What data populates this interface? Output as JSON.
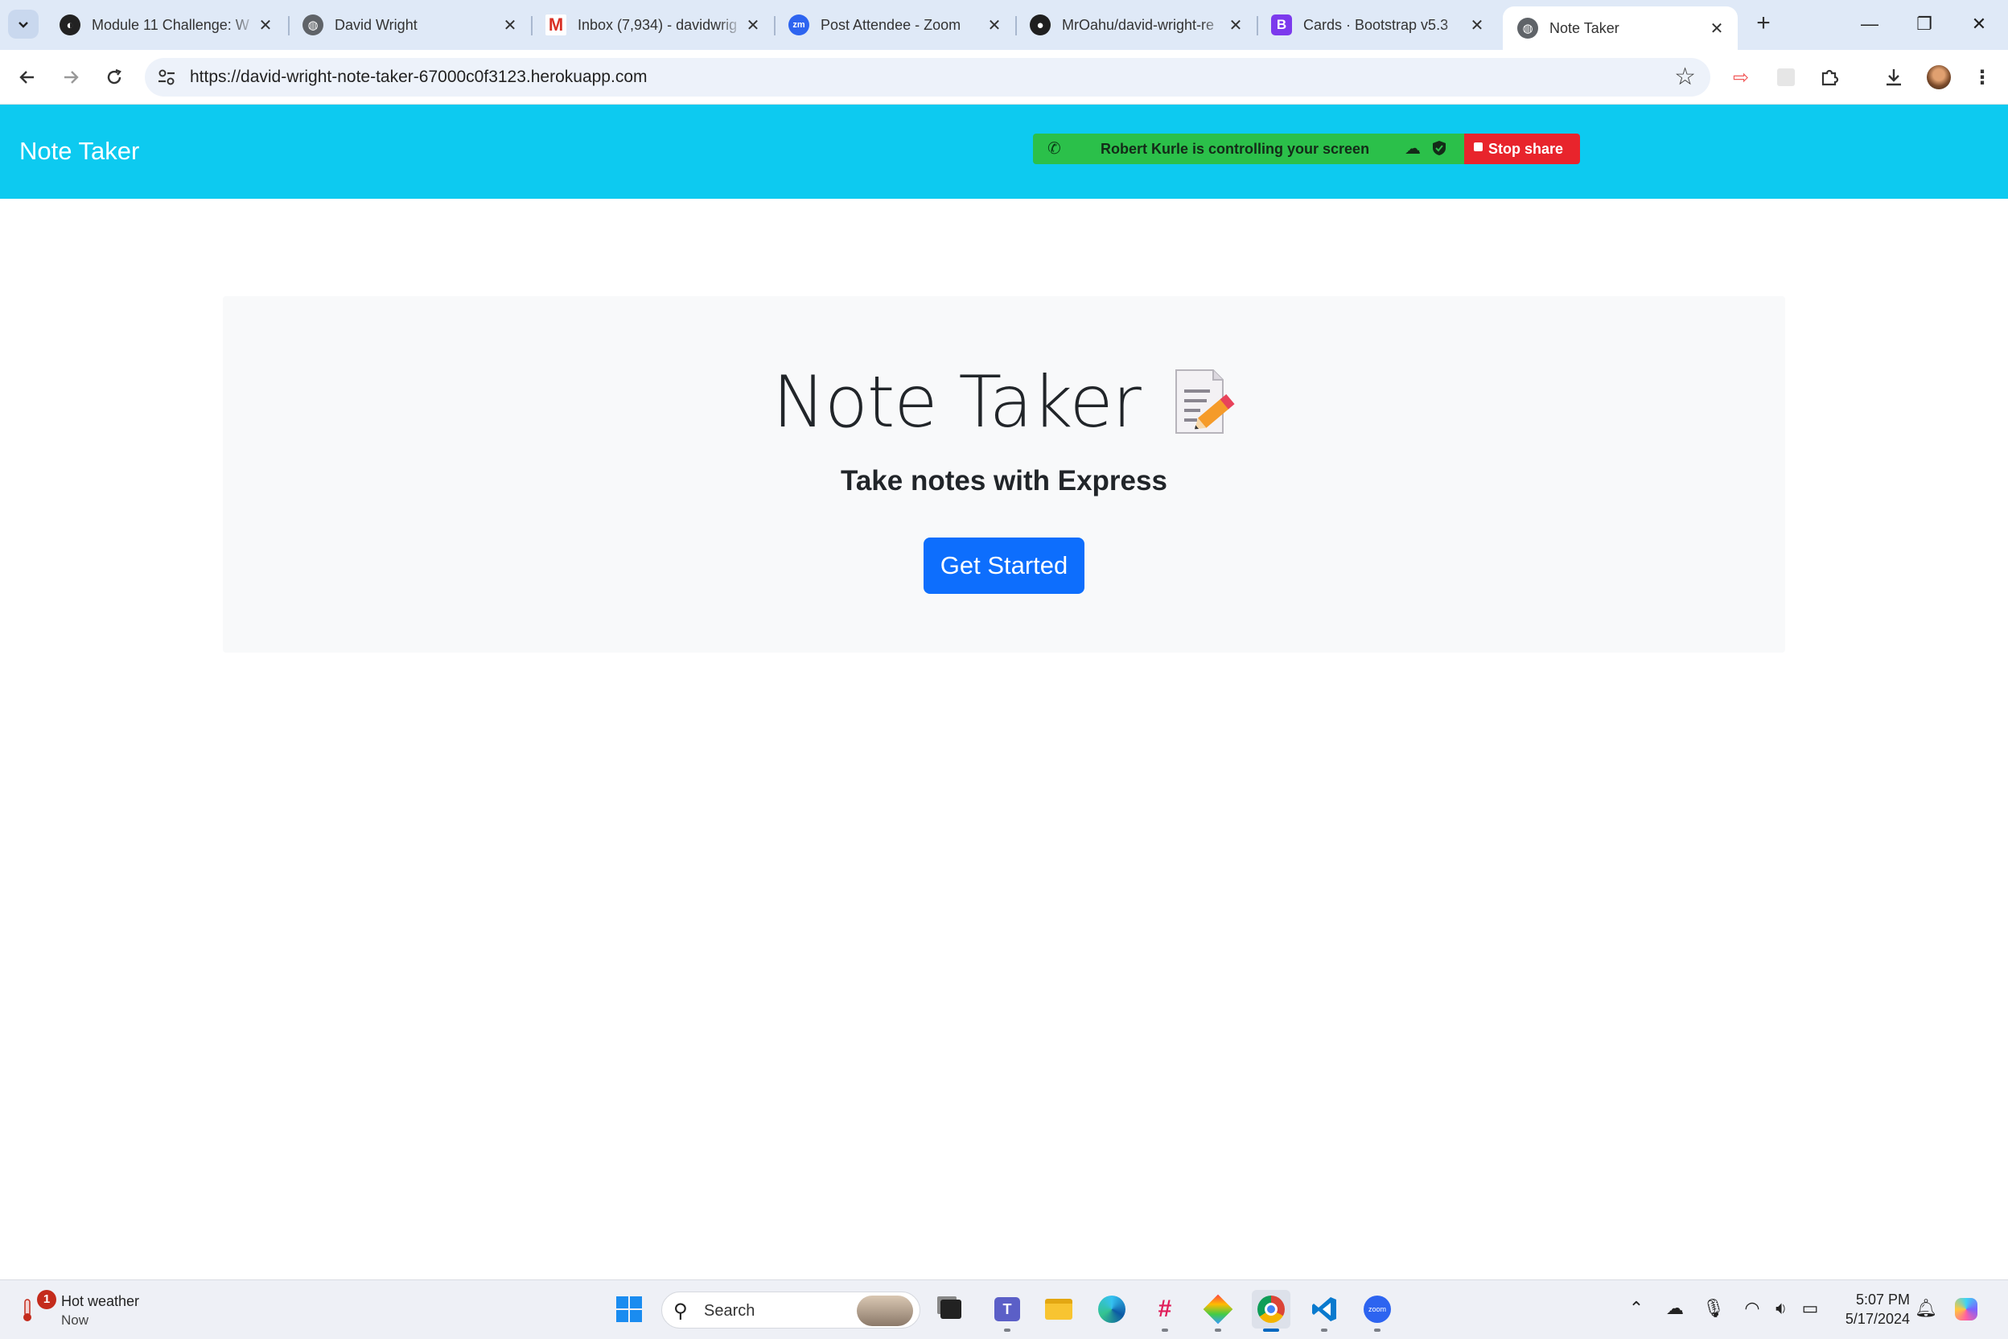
{
  "browser": {
    "tabs": [
      {
        "title": "Module 11 Challenge: W",
        "favicon": "edx-icon",
        "active": false
      },
      {
        "title": "David Wright",
        "favicon": "globe-icon",
        "active": false
      },
      {
        "title": "Inbox (7,934) - davidwrig",
        "favicon": "gmail-icon",
        "active": false
      },
      {
        "title": "Post Attendee - Zoom",
        "favicon": "zoom-icon",
        "active": false
      },
      {
        "title": "MrOahu/david-wright-re",
        "favicon": "github-icon",
        "active": false
      },
      {
        "title": "Cards · Bootstrap v5.3",
        "favicon": "bootstrap-icon",
        "active": false
      },
      {
        "title": "Note Taker",
        "favicon": "globe-icon",
        "active": true
      }
    ],
    "url": "https://david-wright-note-taker-67000c0f3123.herokuapp.com"
  },
  "app": {
    "brand": "Note Taker",
    "navbar_color": "#0dcaf0"
  },
  "share_banner": {
    "message": "Robert Kurle is controlling your screen",
    "stop_label": "Stop share"
  },
  "hero": {
    "title": "Note Taker",
    "subtitle": "Take notes with Express",
    "button_label": "Get Started",
    "button_color": "#0d6efd"
  },
  "taskbar": {
    "weather_title": "Hot weather",
    "weather_time": "Now",
    "weather_badge": "1",
    "search_label": "Search",
    "time": "5:07 PM",
    "date": "5/17/2024"
  }
}
